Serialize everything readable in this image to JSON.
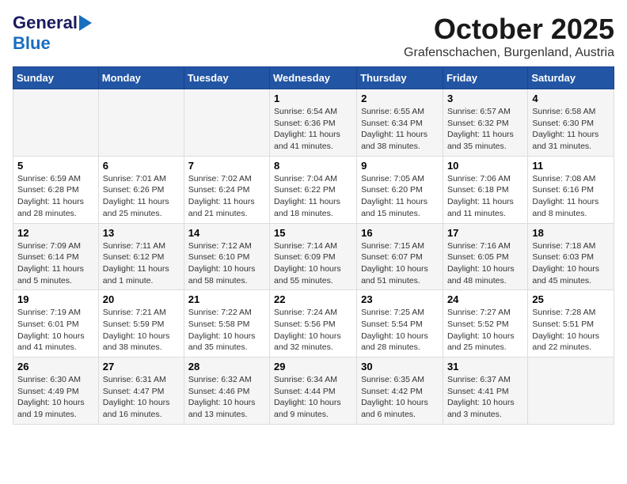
{
  "header": {
    "logo_line1": "General",
    "logo_line2": "Blue",
    "month": "October 2025",
    "location": "Grafenschachen, Burgenland, Austria"
  },
  "days_of_week": [
    "Sunday",
    "Monday",
    "Tuesday",
    "Wednesday",
    "Thursday",
    "Friday",
    "Saturday"
  ],
  "weeks": [
    [
      {
        "day": "",
        "info": ""
      },
      {
        "day": "",
        "info": ""
      },
      {
        "day": "",
        "info": ""
      },
      {
        "day": "1",
        "info": "Sunrise: 6:54 AM\nSunset: 6:36 PM\nDaylight: 11 hours\nand 41 minutes."
      },
      {
        "day": "2",
        "info": "Sunrise: 6:55 AM\nSunset: 6:34 PM\nDaylight: 11 hours\nand 38 minutes."
      },
      {
        "day": "3",
        "info": "Sunrise: 6:57 AM\nSunset: 6:32 PM\nDaylight: 11 hours\nand 35 minutes."
      },
      {
        "day": "4",
        "info": "Sunrise: 6:58 AM\nSunset: 6:30 PM\nDaylight: 11 hours\nand 31 minutes."
      }
    ],
    [
      {
        "day": "5",
        "info": "Sunrise: 6:59 AM\nSunset: 6:28 PM\nDaylight: 11 hours\nand 28 minutes."
      },
      {
        "day": "6",
        "info": "Sunrise: 7:01 AM\nSunset: 6:26 PM\nDaylight: 11 hours\nand 25 minutes."
      },
      {
        "day": "7",
        "info": "Sunrise: 7:02 AM\nSunset: 6:24 PM\nDaylight: 11 hours\nand 21 minutes."
      },
      {
        "day": "8",
        "info": "Sunrise: 7:04 AM\nSunset: 6:22 PM\nDaylight: 11 hours\nand 18 minutes."
      },
      {
        "day": "9",
        "info": "Sunrise: 7:05 AM\nSunset: 6:20 PM\nDaylight: 11 hours\nand 15 minutes."
      },
      {
        "day": "10",
        "info": "Sunrise: 7:06 AM\nSunset: 6:18 PM\nDaylight: 11 hours\nand 11 minutes."
      },
      {
        "day": "11",
        "info": "Sunrise: 7:08 AM\nSunset: 6:16 PM\nDaylight: 11 hours\nand 8 minutes."
      }
    ],
    [
      {
        "day": "12",
        "info": "Sunrise: 7:09 AM\nSunset: 6:14 PM\nDaylight: 11 hours\nand 5 minutes."
      },
      {
        "day": "13",
        "info": "Sunrise: 7:11 AM\nSunset: 6:12 PM\nDaylight: 11 hours\nand 1 minute."
      },
      {
        "day": "14",
        "info": "Sunrise: 7:12 AM\nSunset: 6:10 PM\nDaylight: 10 hours\nand 58 minutes."
      },
      {
        "day": "15",
        "info": "Sunrise: 7:14 AM\nSunset: 6:09 PM\nDaylight: 10 hours\nand 55 minutes."
      },
      {
        "day": "16",
        "info": "Sunrise: 7:15 AM\nSunset: 6:07 PM\nDaylight: 10 hours\nand 51 minutes."
      },
      {
        "day": "17",
        "info": "Sunrise: 7:16 AM\nSunset: 6:05 PM\nDaylight: 10 hours\nand 48 minutes."
      },
      {
        "day": "18",
        "info": "Sunrise: 7:18 AM\nSunset: 6:03 PM\nDaylight: 10 hours\nand 45 minutes."
      }
    ],
    [
      {
        "day": "19",
        "info": "Sunrise: 7:19 AM\nSunset: 6:01 PM\nDaylight: 10 hours\nand 41 minutes."
      },
      {
        "day": "20",
        "info": "Sunrise: 7:21 AM\nSunset: 5:59 PM\nDaylight: 10 hours\nand 38 minutes."
      },
      {
        "day": "21",
        "info": "Sunrise: 7:22 AM\nSunset: 5:58 PM\nDaylight: 10 hours\nand 35 minutes."
      },
      {
        "day": "22",
        "info": "Sunrise: 7:24 AM\nSunset: 5:56 PM\nDaylight: 10 hours\nand 32 minutes."
      },
      {
        "day": "23",
        "info": "Sunrise: 7:25 AM\nSunset: 5:54 PM\nDaylight: 10 hours\nand 28 minutes."
      },
      {
        "day": "24",
        "info": "Sunrise: 7:27 AM\nSunset: 5:52 PM\nDaylight: 10 hours\nand 25 minutes."
      },
      {
        "day": "25",
        "info": "Sunrise: 7:28 AM\nSunset: 5:51 PM\nDaylight: 10 hours\nand 22 minutes."
      }
    ],
    [
      {
        "day": "26",
        "info": "Sunrise: 6:30 AM\nSunset: 4:49 PM\nDaylight: 10 hours\nand 19 minutes."
      },
      {
        "day": "27",
        "info": "Sunrise: 6:31 AM\nSunset: 4:47 PM\nDaylight: 10 hours\nand 16 minutes."
      },
      {
        "day": "28",
        "info": "Sunrise: 6:32 AM\nSunset: 4:46 PM\nDaylight: 10 hours\nand 13 minutes."
      },
      {
        "day": "29",
        "info": "Sunrise: 6:34 AM\nSunset: 4:44 PM\nDaylight: 10 hours\nand 9 minutes."
      },
      {
        "day": "30",
        "info": "Sunrise: 6:35 AM\nSunset: 4:42 PM\nDaylight: 10 hours\nand 6 minutes."
      },
      {
        "day": "31",
        "info": "Sunrise: 6:37 AM\nSunset: 4:41 PM\nDaylight: 10 hours\nand 3 minutes."
      },
      {
        "day": "",
        "info": ""
      }
    ]
  ]
}
